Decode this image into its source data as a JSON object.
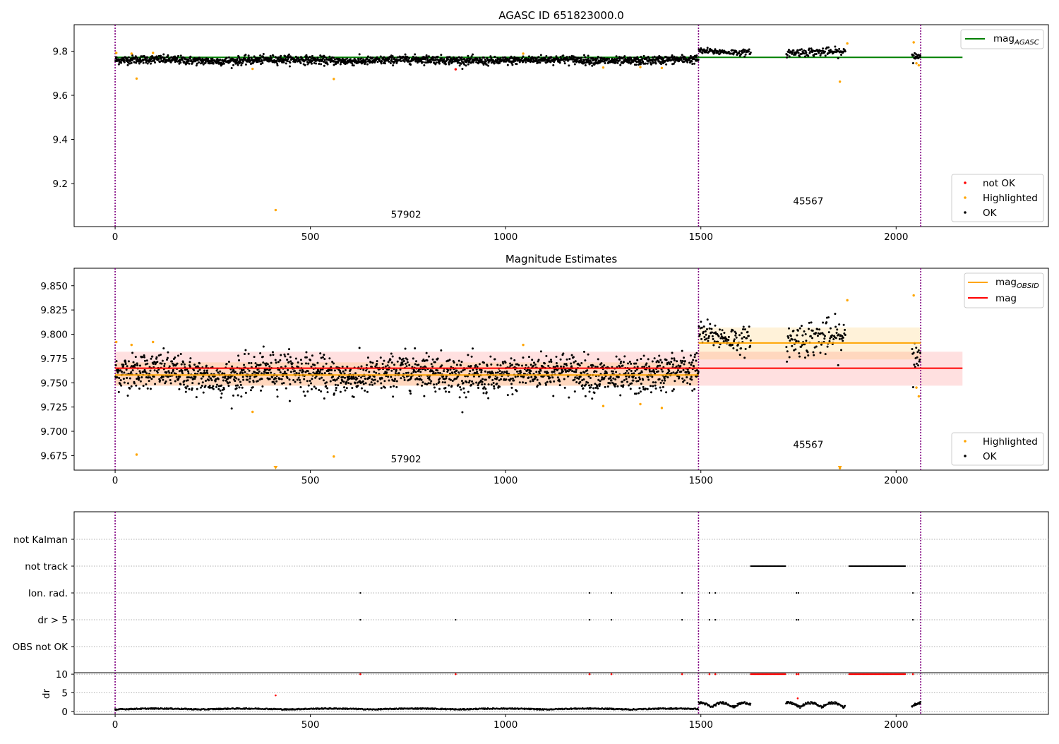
{
  "chart_data": [
    {
      "type": "scatter",
      "title": "AGASC ID 651823000.0",
      "xlabel": "",
      "ylabel": "",
      "xlim": [
        -105,
        2390
      ],
      "ylim": [
        9.005,
        9.92
      ],
      "xticks": [
        0,
        500,
        1000,
        1500,
        2000
      ],
      "yticks": [
        9.2,
        9.4,
        9.6,
        9.8
      ],
      "tick_labels_y": [
        "9.2",
        "9.4",
        "9.6",
        "9.8"
      ],
      "vlines": [
        0,
        1494,
        2063
      ],
      "obsid_labels": [
        {
          "text": "57902",
          "x": 745,
          "y": 9.045
        },
        {
          "text": "45567",
          "x": 1775,
          "y": 9.105
        }
      ],
      "hlines": [
        {
          "name": "mag_AGASC",
          "y": 9.772,
          "x_range": [
            0,
            2170
          ],
          "color": "#008000"
        }
      ],
      "segments": [
        {
          "x_range": [
            0,
            1494
          ],
          "mean": 9.759,
          "sd": 0.011
        },
        {
          "x_range": [
            1494,
            1628
          ],
          "mean": 9.797,
          "sd": 0.008
        },
        {
          "x_range": [
            1718,
            1870
          ],
          "mean": 9.793,
          "sd": 0.011
        },
        {
          "x_range": [
            2040,
            2063
          ],
          "mean": 9.78,
          "sd": 0.016
        }
      ],
      "highlighted_points": [
        [
          3,
          9.792
        ],
        [
          42,
          9.789
        ],
        [
          55,
          9.676
        ],
        [
          97,
          9.792
        ],
        [
          352,
          9.72
        ],
        [
          411,
          9.08
        ],
        [
          560,
          9.674
        ],
        [
          1045,
          9.789
        ],
        [
          1250,
          9.726
        ],
        [
          1345,
          9.728
        ],
        [
          1400,
          9.724
        ],
        [
          1856,
          9.662
        ],
        [
          1875,
          9.835
        ],
        [
          2045,
          9.84
        ],
        [
          2052,
          9.745
        ],
        [
          2058,
          9.736
        ]
      ],
      "not_ok_points": [
        [
          872,
          9.718
        ]
      ],
      "legend_top": {
        "entries": [
          "mag_AGASC"
        ],
        "placement": "top-right"
      },
      "legend_bottom": {
        "entries": [
          "not OK",
          "Highlighted",
          "OK"
        ],
        "placement": "lower-right"
      },
      "series_colors": {
        "ok": "#000000",
        "highlighted": "#ffa500",
        "not_ok": "#ff0000"
      }
    },
    {
      "type": "scatter",
      "title": "Magnitude Estimates",
      "xlabel": "",
      "ylabel": "",
      "xlim": [
        -105,
        2390
      ],
      "ylim": [
        9.66,
        9.868
      ],
      "xticks": [
        0,
        500,
        1000,
        1500,
        2000
      ],
      "yticks": [
        9.675,
        9.7,
        9.725,
        9.75,
        9.775,
        9.8,
        9.825,
        9.85
      ],
      "tick_labels_y": [
        "9.675",
        "9.700",
        "9.725",
        "9.750",
        "9.775",
        "9.800",
        "9.825",
        "9.850"
      ],
      "vlines": [
        0,
        1494,
        2063
      ],
      "obsid_labels": [
        {
          "text": "57902",
          "x": 745,
          "y": 9.668
        },
        {
          "text": "45567",
          "x": 1775,
          "y": 9.683
        }
      ],
      "mag": {
        "value": 9.765,
        "band": [
          9.747,
          9.782
        ],
        "x_range": [
          0,
          2170
        ],
        "color": "#ff0000"
      },
      "mag_obsid": [
        {
          "x_range": [
            0,
            1494
          ],
          "value": 9.758,
          "band": [
            9.747,
            9.771
          ]
        },
        {
          "x_range": [
            1494,
            2063
          ],
          "value": 9.791,
          "band": [
            9.774,
            9.807
          ]
        }
      ],
      "off_scale_markers": [
        411,
        1856
      ],
      "legend_top": {
        "entries": [
          "mag_OBSID",
          "mag"
        ],
        "placement": "top-right"
      },
      "legend_bottom": {
        "entries": [
          "Highlighted",
          "OK"
        ],
        "placement": "lower-right"
      }
    },
    {
      "type": "scatter",
      "title": "",
      "xlim": [
        -105,
        2390
      ],
      "xticks": [
        0,
        500,
        1000,
        1500,
        2000
      ],
      "vlines": [
        0,
        1494,
        2063
      ],
      "flag_rows": [
        "not Kalman",
        "not track",
        "Ion. rad.",
        "dr > 5",
        "OBS not OK"
      ],
      "not_track_ranges": [
        [
          1628,
          1718
        ],
        [
          1880,
          2025
        ]
      ],
      "ion_rad_x": [
        628,
        1215,
        1271,
        1452,
        1522,
        1537,
        1745,
        1750,
        2043
      ],
      "dr_gt5_x": [
        628,
        872,
        1215,
        1271,
        1452,
        1522,
        1537,
        1745,
        1750,
        2043
      ]
    },
    {
      "type": "scatter",
      "title": "",
      "xlabel": "",
      "ylabel": "dr",
      "xlim": [
        -105,
        2390
      ],
      "ylim": [
        -0.8,
        10.4
      ],
      "yticks": [
        0,
        5,
        10
      ],
      "xticks": [
        0,
        500,
        1000,
        1500,
        2000
      ],
      "vlines": [
        0,
        1494,
        2063
      ],
      "clipped_value": 10,
      "high_points": [
        [
          411,
          4.3
        ],
        [
          1748,
          3.5
        ]
      ]
    }
  ]
}
